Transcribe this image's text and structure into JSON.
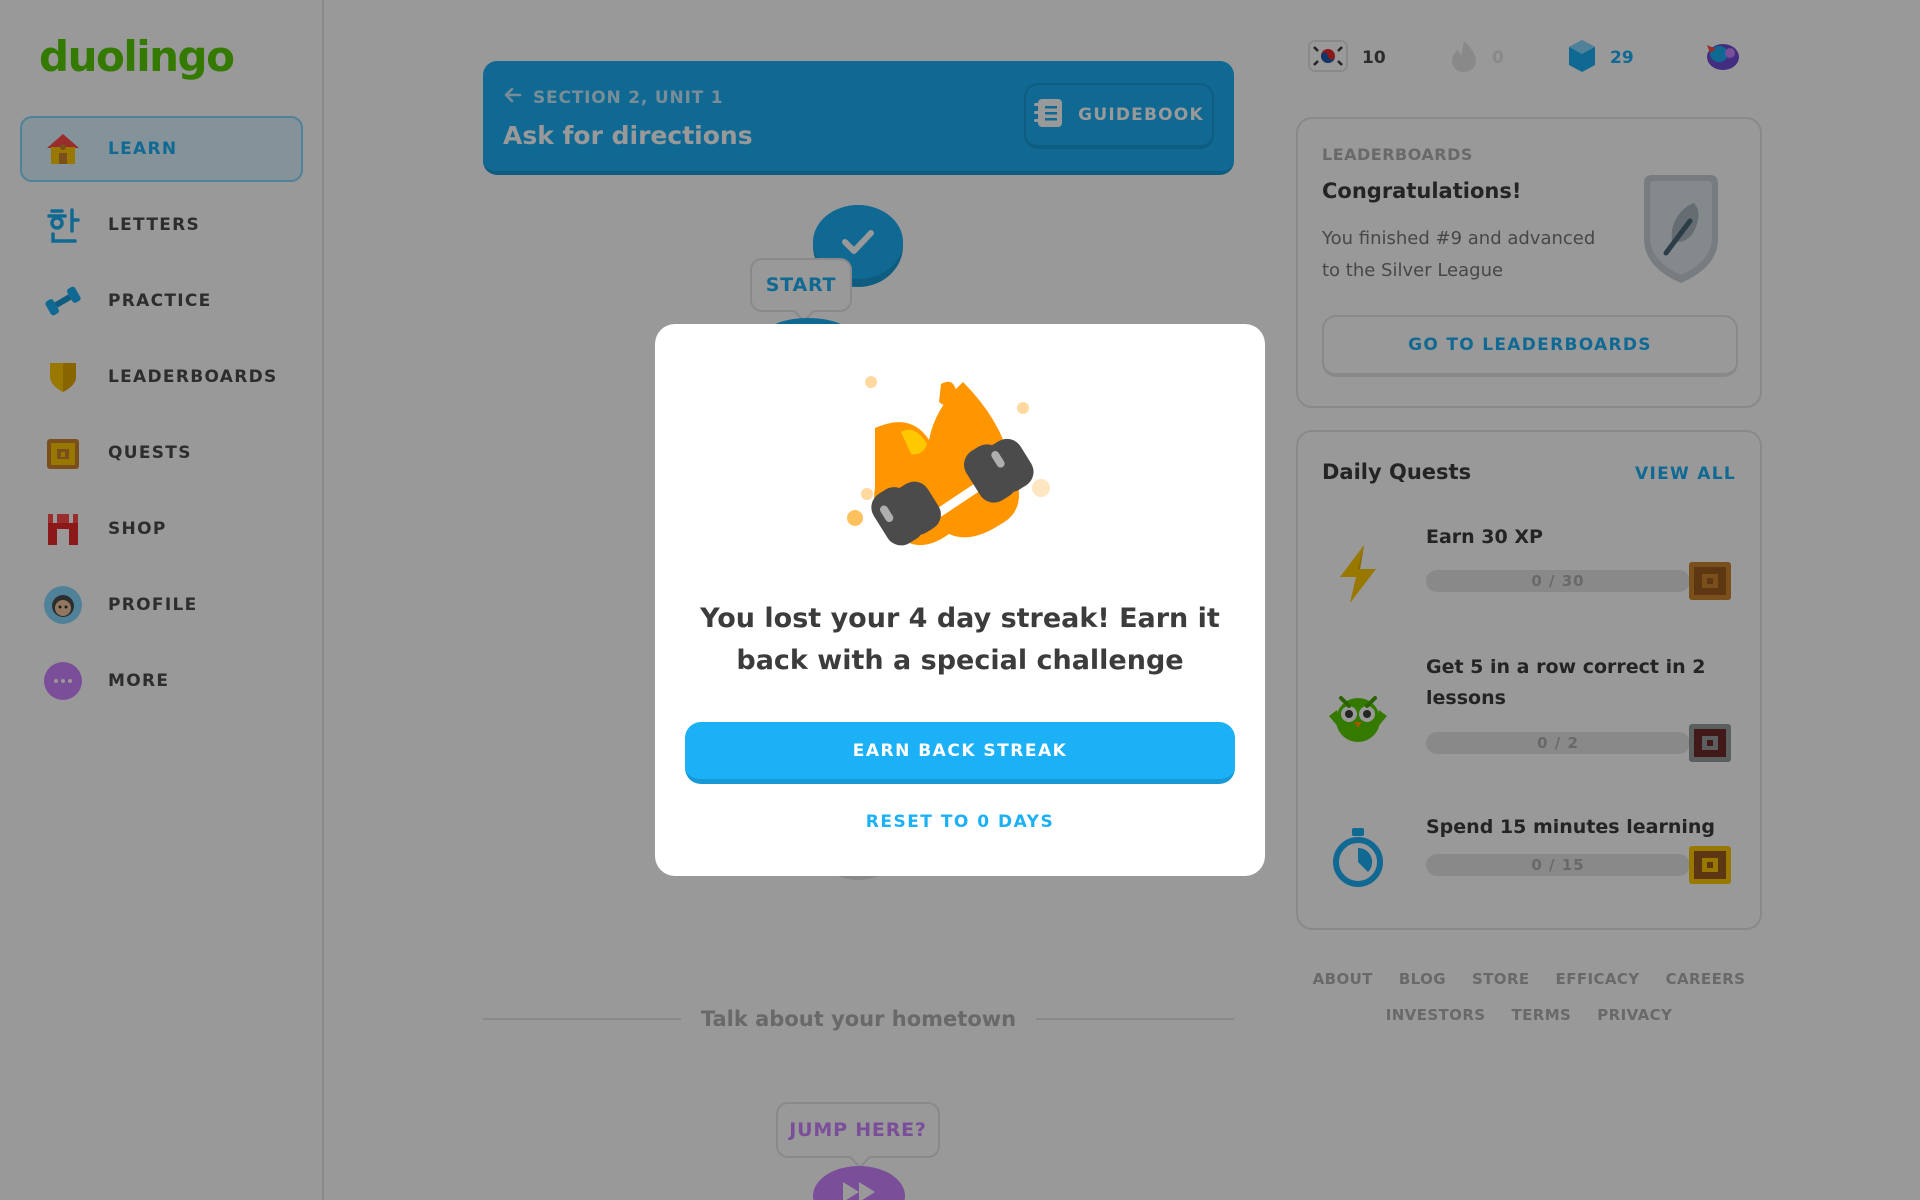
{
  "app": {
    "logo": "duolingo"
  },
  "sidebar": {
    "items": [
      {
        "label": "LEARN",
        "icon": "house-icon",
        "active": true
      },
      {
        "label": "LETTERS",
        "icon": "hangul-letter-icon"
      },
      {
        "label": "PRACTICE",
        "icon": "dumbbell-icon"
      },
      {
        "label": "LEADERBOARDS",
        "icon": "shield-icon"
      },
      {
        "label": "QUESTS",
        "icon": "treasure-chest-icon"
      },
      {
        "label": "SHOP",
        "icon": "shop-icon"
      },
      {
        "label": "PROFILE",
        "icon": "avatar-icon"
      },
      {
        "label": "MORE",
        "icon": "more-dots-icon"
      }
    ]
  },
  "unit": {
    "section_label": "SECTION 2, UNIT 1",
    "title": "Ask for directions",
    "guidebook_label": "GUIDEBOOK"
  },
  "path": {
    "start_label": "START",
    "next_section": "Talk about your hometown",
    "jump_label": "JUMP HERE?"
  },
  "stats": {
    "language": "korean-flag-icon",
    "language_count": "10",
    "streak": "0",
    "gems": "29"
  },
  "leaderboard": {
    "kicker": "LEADERBOARDS",
    "title": "Congratulations!",
    "text": "You finished #9 and advanced to the Silver League",
    "button": "GO TO LEADERBOARDS"
  },
  "quests": {
    "title": "Daily Quests",
    "view_all": "VIEW ALL",
    "items": [
      {
        "name": "Earn 30 XP",
        "progress_text": "0 / 30",
        "current": 0,
        "total": 30,
        "icon": "lightning-icon"
      },
      {
        "name": "Get 5 in a row correct in 2 lessons",
        "progress_text": "0 / 2",
        "current": 0,
        "total": 2,
        "icon": "owl-icon"
      },
      {
        "name": "Spend 15 minutes learning",
        "progress_text": "0 / 15",
        "current": 0,
        "total": 15,
        "icon": "stopwatch-icon"
      }
    ]
  },
  "footer": {
    "row1": [
      "ABOUT",
      "BLOG",
      "STORE",
      "EFFICACY",
      "CAREERS"
    ],
    "row2": [
      "INVESTORS",
      "TERMS",
      "PRIVACY"
    ]
  },
  "modal": {
    "message": "You lost your 4 day streak! Earn it back with a special challenge",
    "primary": "EARN BACK STREAK",
    "secondary": "RESET TO 0 DAYS"
  },
  "colors": {
    "brand_green": "#58cc02",
    "accent_blue": "#1cb0f6",
    "accent_blue_dark": "#1899d6",
    "flame_orange": "#ff9600",
    "purple": "#ce82ff"
  }
}
